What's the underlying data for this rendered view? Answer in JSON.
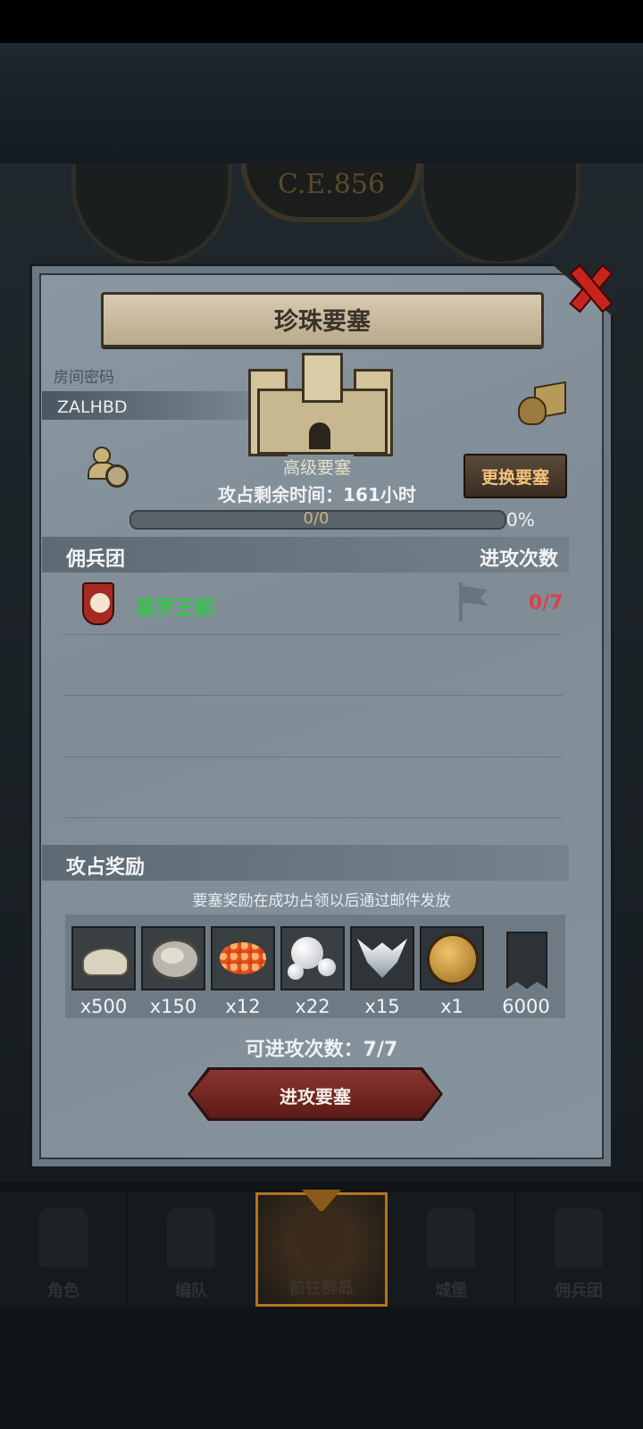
{
  "background": {
    "era_text": "C.E.856"
  },
  "dialog": {
    "title": "珍珠要塞",
    "room_label": "房间密码",
    "room_code": "ZALHBD",
    "fortress_type": "高级要塞",
    "change_button": "更换要塞",
    "time_label": "攻占剩余时间：161小时",
    "progress": {
      "text": "0/0",
      "percent_text": "0%",
      "fraction": 0.0
    },
    "mercenary_header": "佣兵团",
    "attacks_header": "进攻次数",
    "guilds": [
      {
        "name": "星罗王朝",
        "attacks": "0/7",
        "name_color": "#35c24a",
        "attacks_color": "#d8424a"
      }
    ],
    "reward_header": "攻占奖励",
    "reward_note": "要塞奖励在成功占领以后通过邮件发放",
    "rewards": [
      {
        "icon": "sand-pile-icon",
        "qty": "x500"
      },
      {
        "icon": "oyster-icon",
        "qty": "x150"
      },
      {
        "icon": "fish-roe-icon",
        "qty": "x12"
      },
      {
        "icon": "pearls-icon",
        "qty": "x22"
      },
      {
        "icon": "winged-emblem-icon",
        "qty": "x15"
      },
      {
        "icon": "golden-helmet-icon",
        "qty": "x1"
      },
      {
        "icon": "war-banner-icon",
        "qty": "6000"
      }
    ],
    "attempts_text": "可进攻次数：7/7",
    "attack_button": "进攻要塞"
  },
  "nav": {
    "items": [
      {
        "label": "角色",
        "icon": "knight-icon",
        "active": false
      },
      {
        "label": "编队",
        "icon": "formation-icon",
        "active": false
      },
      {
        "label": "前往群岛",
        "icon": "compass-icon",
        "active": true
      },
      {
        "label": "城堡",
        "icon": "castle-icon",
        "active": false
      },
      {
        "label": "佣兵团",
        "icon": "mercenary-icon",
        "active": false
      }
    ]
  },
  "colors": {
    "accent_gold": "#f1c57c",
    "guild_green": "#35c24a",
    "alert_red": "#d8424a",
    "button_red": "#8a3530"
  }
}
